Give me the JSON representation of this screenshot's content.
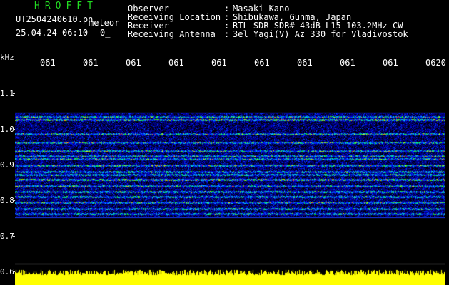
{
  "header": {
    "brand": "HROFFT",
    "filename": "UT2504240610.pn",
    "mode": "meteor",
    "datetime": "25.04.24 06:10",
    "index": "0_",
    "fields": [
      {
        "label": "Observer",
        "value": "Masaki Kano"
      },
      {
        "label": "Receiving Location",
        "value": "Shibukawa, Gunma, Japan"
      },
      {
        "label": "Receiver",
        "value": "RTL-SDR SDR# 43dB L15 103.2MHz CW"
      },
      {
        "label": "Receiving Antenna",
        "value": "3el Yagi(V) Az 330 for Vladivostok"
      }
    ],
    "separator": ":"
  },
  "axis": {
    "unit": "kHz",
    "y_ticks": [
      "1.1",
      "1.0",
      "0.9",
      "0.8",
      "0.7",
      "0.6"
    ],
    "x_ticks": [
      "061",
      "061",
      "061",
      "061",
      "061",
      "061",
      "061",
      "061",
      "061",
      "0620"
    ]
  },
  "colors": {
    "background": "#000000",
    "spectrum_low": "#000088",
    "spectrum_mid": "#00c8ff",
    "spectrum_high": "#ff2000",
    "amplitude": "#ffff00",
    "brand": "#22dd22"
  }
}
